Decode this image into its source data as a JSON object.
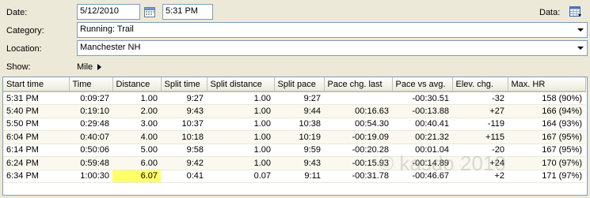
{
  "form": {
    "date_label": "Date:",
    "date_value": "5/12/2010",
    "time_value": "5:31 PM",
    "data_label": "Data:",
    "category_label": "Category:",
    "category_value": "Running: Trail",
    "location_label": "Location:",
    "location_value": "Manchester NH",
    "show_label": "Show:",
    "show_value": "Mile"
  },
  "icons": {
    "calendar": "calendar-icon",
    "data": "data-icon",
    "dropdown": "chevron-down-icon",
    "expand": "triangle-right-icon"
  },
  "table": {
    "columns": [
      "Start time",
      "Time",
      "Distance",
      "Split time",
      "Split distance",
      "Split pace",
      "Pace chg. last",
      "Pace vs avg.",
      "Elev. chg.",
      "Max. HR"
    ],
    "rows": [
      [
        "5:31 PM",
        "0:09:27",
        "1.00",
        "9:27",
        "1.00",
        "9:27",
        "",
        "-00:30.51",
        "-32",
        "158 (90%)"
      ],
      [
        "5:40 PM",
        "0:19:10",
        "2.00",
        "9:43",
        "1.00",
        "9:44",
        "00:16.63",
        "-00:13.88",
        "+27",
        "166 (94%)"
      ],
      [
        "5:50 PM",
        "0:29:48",
        "3.00",
        "10:37",
        "1.00",
        "10:38",
        "00:54.30",
        "00:40.41",
        "-119",
        "164 (93%)"
      ],
      [
        "6:04 PM",
        "0:40:07",
        "4.00",
        "10:18",
        "1.00",
        "10:19",
        "-00:19.09",
        "00:21.32",
        "+115",
        "167 (95%)"
      ],
      [
        "6:14 PM",
        "0:50:06",
        "5.00",
        "9:58",
        "1.00",
        "9:59",
        "-00:20.28",
        "00:01.04",
        "-20",
        "167 (95%)"
      ],
      [
        "6:24 PM",
        "0:59:48",
        "6.00",
        "9:42",
        "1.00",
        "9:43",
        "-00:15.93",
        "-00:14.89",
        "+24",
        "170 (97%)"
      ],
      [
        "6:34 PM",
        "1:00:30",
        "6.07",
        "0:41",
        "0.07",
        "9:11",
        "-00:31.78",
        "-00:46.67",
        "+2",
        "171 (97%)"
      ]
    ],
    "highlight": {
      "row": 6,
      "col": 2,
      "color": "#ffff66"
    }
  },
  "watermark": "© kasdo 2010"
}
